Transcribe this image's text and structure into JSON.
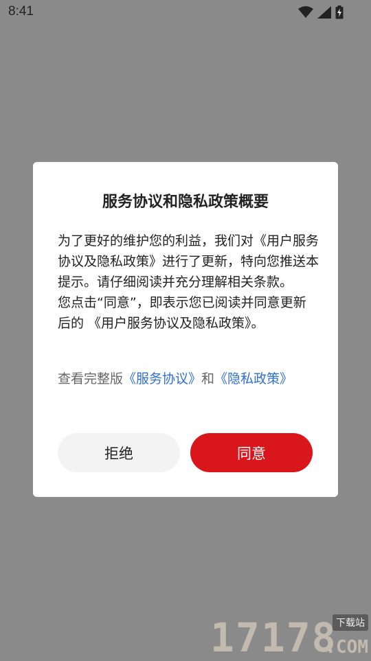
{
  "status_bar": {
    "time": "8:41",
    "icons": [
      "wifi-icon",
      "signal-icon",
      "battery-charging-icon"
    ]
  },
  "dialog": {
    "title": "服务协议和隐私政策概要",
    "body": "为了更好的维护您的利益，我们对《用户服务协议及隐私政策》进行了更新，特向您推送本提示。请仔细阅读并充分理解相关条款。\n您点击“同意”，即表示您已阅读并同意更新后的 《用户服务协议及隐私政策》。",
    "links_prefix": "查看完整版",
    "link_service": "《服务协议》",
    "links_and": "和",
    "link_privacy": "《隐私政策》",
    "reject_label": "拒绝",
    "agree_label": "同意"
  },
  "colors": {
    "overlay": "#8a8a8a",
    "accent": "#d8161b",
    "link": "#2f6fd6"
  },
  "watermark": {
    "digits": "17178",
    "tag": "下载站",
    "domain": ".COM"
  }
}
